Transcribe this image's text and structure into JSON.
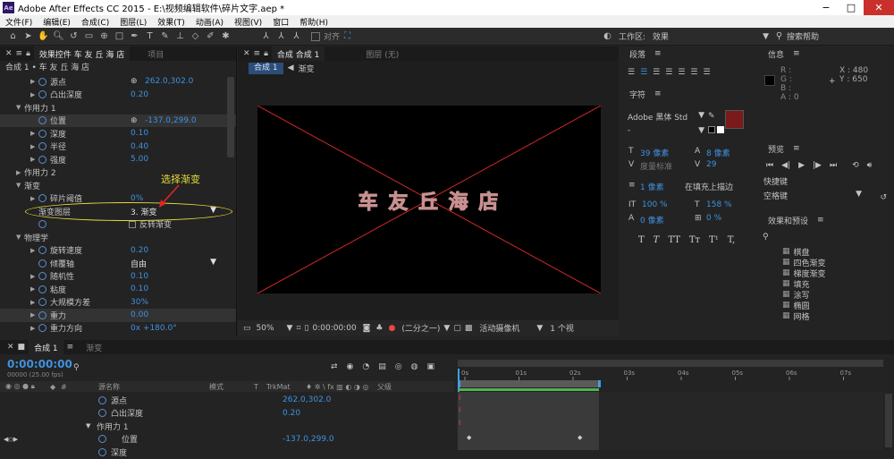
{
  "titlebar": {
    "logo": "Ae",
    "title": "Adobe After Effects CC 2015 - E:\\视频编辑软件\\碎片文字.aep *"
  },
  "menu": [
    "文件(F)",
    "编辑(E)",
    "合成(C)",
    "图层(L)",
    "效果(T)",
    "动画(A)",
    "视图(V)",
    "窗口",
    "帮助(H)"
  ],
  "toolbar": {
    "align_label": "对齐",
    "workspace_label": "工作区:",
    "workspace_value": "效果",
    "search_help": "搜索帮助"
  },
  "effects_panel": {
    "tab_label": "效果控件 车 友 丘 海 店",
    "project_tab": "项目",
    "breadcrumb": "合成 1 • 车 友 丘 海 店",
    "rows": [
      {
        "label": "源点",
        "value": "262.0,302.0"
      },
      {
        "label": "凸出深度",
        "value": "0.20"
      },
      {
        "label": "作用力 1",
        "value": ""
      },
      {
        "label": "位置",
        "value": "-137.0,299.0"
      },
      {
        "label": "深度",
        "value": "0.10"
      },
      {
        "label": "半径",
        "value": "0.40"
      },
      {
        "label": "强度",
        "value": "5.00"
      },
      {
        "label": "作用力 2",
        "value": ""
      },
      {
        "label": "渐变",
        "value": ""
      },
      {
        "label": "碎片阈值",
        "value": "0%"
      },
      {
        "label": "渐变图层",
        "value": "3. 渐变"
      },
      {
        "label": "",
        "value": "反转渐变"
      },
      {
        "label": "物理学",
        "value": ""
      },
      {
        "label": "旋转速度",
        "value": "0.20"
      },
      {
        "label": "倾覆轴",
        "value": "自由"
      },
      {
        "label": "随机性",
        "value": "0.10"
      },
      {
        "label": "粘度",
        "value": "0.10"
      },
      {
        "label": "大规模方差",
        "value": "30%"
      },
      {
        "label": "重力",
        "value": "0.00"
      },
      {
        "label": "重力方向",
        "value": "0x +180.0°"
      }
    ],
    "annotation": "选择渐变"
  },
  "comp_panel": {
    "tab_label": "合成 合成 1",
    "layer_tab": "图层 (无)",
    "flow_label": "合成 1",
    "layer_name": "渐变",
    "comp_text": "车 友 丘 海 店",
    "zoom": "50%",
    "timecode": "0:00:00:00",
    "resolution": "(二分之一)",
    "camera": "活动摄像机",
    "views": "1 个视"
  },
  "paragraph_panel": {
    "title": "段落"
  },
  "char_panel": {
    "title": "字符",
    "font": "Adobe 黑体 Std",
    "style": "-",
    "size": "39 像素",
    "leading": "8 像素",
    "kerning": "度量标准",
    "tracking": "29",
    "stroke_width": "1 像素",
    "stroke_mode": "在填充上描边",
    "vscale": "100 %",
    "hscale": "158 %",
    "baseline": "0 像素",
    "tsume": "0 %",
    "styles": [
      "T",
      "T",
      "TT",
      "Tт",
      "T¹",
      "T,"
    ],
    "fill_color": "#7a1a1a"
  },
  "info_panel": {
    "title": "信息",
    "r": "R :",
    "g": "G :",
    "b": "B :",
    "a": "A : 0",
    "x": "X : 480",
    "y": "Y : 650"
  },
  "preview_panel": {
    "title": "预览",
    "shortcut_label": "快捷键",
    "shortcut_value": "空格键"
  },
  "effects_presets": {
    "title": "效果和预设",
    "items": [
      "棋盘",
      "四色渐变",
      "梯度渐变",
      "填充",
      "涂写",
      "椭圆",
      "网格"
    ]
  },
  "timeline": {
    "tab_label": "合成 1",
    "render_tab": "渐变",
    "timecode": "0:00:00:00",
    "fps": "00000 (25.00 fps)",
    "col_name": "源名称",
    "col_mode": "模式",
    "col_t": "T",
    "col_trk": "TrkMat",
    "col_parent": "父级",
    "ticks": [
      "0s",
      "01s",
      "02s",
      "03s",
      "04s",
      "05s",
      "06s",
      "07s"
    ],
    "rows": [
      {
        "label": "源点",
        "value": "262.0,302.0"
      },
      {
        "label": "凸出深度",
        "value": "0.20"
      },
      {
        "label": "作用力 1",
        "value": ""
      },
      {
        "label": "位置",
        "value": "-137.0,299.0"
      },
      {
        "label": "深度",
        "value": ""
      }
    ]
  }
}
